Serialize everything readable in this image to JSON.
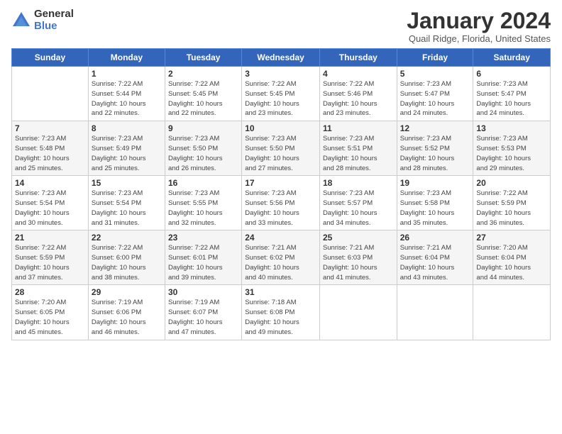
{
  "logo": {
    "general": "General",
    "blue": "Blue"
  },
  "header": {
    "title": "January 2024",
    "location": "Quail Ridge, Florida, United States"
  },
  "weekdays": [
    "Sunday",
    "Monday",
    "Tuesday",
    "Wednesday",
    "Thursday",
    "Friday",
    "Saturday"
  ],
  "weeks": [
    [
      {
        "day": "",
        "info": ""
      },
      {
        "day": "1",
        "info": "Sunrise: 7:22 AM\nSunset: 5:44 PM\nDaylight: 10 hours\nand 22 minutes."
      },
      {
        "day": "2",
        "info": "Sunrise: 7:22 AM\nSunset: 5:45 PM\nDaylight: 10 hours\nand 22 minutes."
      },
      {
        "day": "3",
        "info": "Sunrise: 7:22 AM\nSunset: 5:45 PM\nDaylight: 10 hours\nand 23 minutes."
      },
      {
        "day": "4",
        "info": "Sunrise: 7:22 AM\nSunset: 5:46 PM\nDaylight: 10 hours\nand 23 minutes."
      },
      {
        "day": "5",
        "info": "Sunrise: 7:23 AM\nSunset: 5:47 PM\nDaylight: 10 hours\nand 24 minutes."
      },
      {
        "day": "6",
        "info": "Sunrise: 7:23 AM\nSunset: 5:47 PM\nDaylight: 10 hours\nand 24 minutes."
      }
    ],
    [
      {
        "day": "7",
        "info": "Sunrise: 7:23 AM\nSunset: 5:48 PM\nDaylight: 10 hours\nand 25 minutes."
      },
      {
        "day": "8",
        "info": "Sunrise: 7:23 AM\nSunset: 5:49 PM\nDaylight: 10 hours\nand 25 minutes."
      },
      {
        "day": "9",
        "info": "Sunrise: 7:23 AM\nSunset: 5:50 PM\nDaylight: 10 hours\nand 26 minutes."
      },
      {
        "day": "10",
        "info": "Sunrise: 7:23 AM\nSunset: 5:50 PM\nDaylight: 10 hours\nand 27 minutes."
      },
      {
        "day": "11",
        "info": "Sunrise: 7:23 AM\nSunset: 5:51 PM\nDaylight: 10 hours\nand 28 minutes."
      },
      {
        "day": "12",
        "info": "Sunrise: 7:23 AM\nSunset: 5:52 PM\nDaylight: 10 hours\nand 28 minutes."
      },
      {
        "day": "13",
        "info": "Sunrise: 7:23 AM\nSunset: 5:53 PM\nDaylight: 10 hours\nand 29 minutes."
      }
    ],
    [
      {
        "day": "14",
        "info": "Sunrise: 7:23 AM\nSunset: 5:54 PM\nDaylight: 10 hours\nand 30 minutes."
      },
      {
        "day": "15",
        "info": "Sunrise: 7:23 AM\nSunset: 5:54 PM\nDaylight: 10 hours\nand 31 minutes."
      },
      {
        "day": "16",
        "info": "Sunrise: 7:23 AM\nSunset: 5:55 PM\nDaylight: 10 hours\nand 32 minutes."
      },
      {
        "day": "17",
        "info": "Sunrise: 7:23 AM\nSunset: 5:56 PM\nDaylight: 10 hours\nand 33 minutes."
      },
      {
        "day": "18",
        "info": "Sunrise: 7:23 AM\nSunset: 5:57 PM\nDaylight: 10 hours\nand 34 minutes."
      },
      {
        "day": "19",
        "info": "Sunrise: 7:23 AM\nSunset: 5:58 PM\nDaylight: 10 hours\nand 35 minutes."
      },
      {
        "day": "20",
        "info": "Sunrise: 7:22 AM\nSunset: 5:59 PM\nDaylight: 10 hours\nand 36 minutes."
      }
    ],
    [
      {
        "day": "21",
        "info": "Sunrise: 7:22 AM\nSunset: 5:59 PM\nDaylight: 10 hours\nand 37 minutes."
      },
      {
        "day": "22",
        "info": "Sunrise: 7:22 AM\nSunset: 6:00 PM\nDaylight: 10 hours\nand 38 minutes."
      },
      {
        "day": "23",
        "info": "Sunrise: 7:22 AM\nSunset: 6:01 PM\nDaylight: 10 hours\nand 39 minutes."
      },
      {
        "day": "24",
        "info": "Sunrise: 7:21 AM\nSunset: 6:02 PM\nDaylight: 10 hours\nand 40 minutes."
      },
      {
        "day": "25",
        "info": "Sunrise: 7:21 AM\nSunset: 6:03 PM\nDaylight: 10 hours\nand 41 minutes."
      },
      {
        "day": "26",
        "info": "Sunrise: 7:21 AM\nSunset: 6:04 PM\nDaylight: 10 hours\nand 43 minutes."
      },
      {
        "day": "27",
        "info": "Sunrise: 7:20 AM\nSunset: 6:04 PM\nDaylight: 10 hours\nand 44 minutes."
      }
    ],
    [
      {
        "day": "28",
        "info": "Sunrise: 7:20 AM\nSunset: 6:05 PM\nDaylight: 10 hours\nand 45 minutes."
      },
      {
        "day": "29",
        "info": "Sunrise: 7:19 AM\nSunset: 6:06 PM\nDaylight: 10 hours\nand 46 minutes."
      },
      {
        "day": "30",
        "info": "Sunrise: 7:19 AM\nSunset: 6:07 PM\nDaylight: 10 hours\nand 47 minutes."
      },
      {
        "day": "31",
        "info": "Sunrise: 7:18 AM\nSunset: 6:08 PM\nDaylight: 10 hours\nand 49 minutes."
      },
      {
        "day": "",
        "info": ""
      },
      {
        "day": "",
        "info": ""
      },
      {
        "day": "",
        "info": ""
      }
    ]
  ]
}
